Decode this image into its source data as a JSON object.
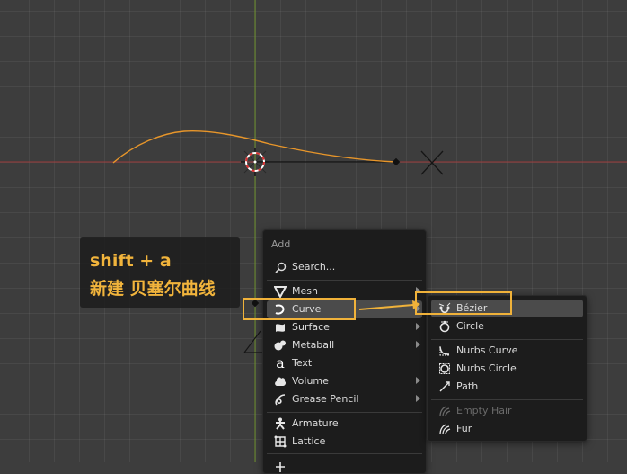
{
  "caption": {
    "line1": "shift + a",
    "line2": "新建 贝塞尔曲线"
  },
  "add_menu": {
    "title": "Add",
    "search_label": "Search...",
    "items": [
      {
        "label": "Mesh",
        "icon": "mesh-icon"
      },
      {
        "label": "Curve",
        "icon": "curve-icon"
      },
      {
        "label": "Surface",
        "icon": "surface-icon"
      },
      {
        "label": "Metaball",
        "icon": "metaball-icon"
      },
      {
        "label": "Text",
        "icon": "text-icon"
      },
      {
        "label": "Volume",
        "icon": "volume-icon"
      },
      {
        "label": "Grease Pencil",
        "icon": "grease-pencil-icon"
      },
      {
        "label": "Armature",
        "icon": "armature-icon"
      },
      {
        "label": "Lattice",
        "icon": "lattice-icon"
      }
    ],
    "active_item": "Curve"
  },
  "curve_submenu": {
    "items": [
      {
        "label": "Bézier",
        "icon": "bezier-icon"
      },
      {
        "label": "Circle",
        "icon": "circle-curve-icon"
      },
      {
        "label": "Nurbs Curve",
        "icon": "nurbs-curve-icon"
      },
      {
        "label": "Nurbs Circle",
        "icon": "nurbs-circle-icon"
      },
      {
        "label": "Path",
        "icon": "path-icon"
      },
      {
        "label": "Empty Hair",
        "icon": "empty-hair-icon"
      },
      {
        "label": "Fur",
        "icon": "fur-icon"
      }
    ],
    "active_item": "Bézier",
    "disabled_item": "Empty Hair"
  },
  "colors": {
    "viewport_bg": "#3d3d3d",
    "x_axis": "#9b3a3a",
    "y_axis": "#6b8f2a",
    "curve": "#e8962a",
    "highlight": "#f0b23a",
    "menu_bg": "#1c1c1c"
  }
}
